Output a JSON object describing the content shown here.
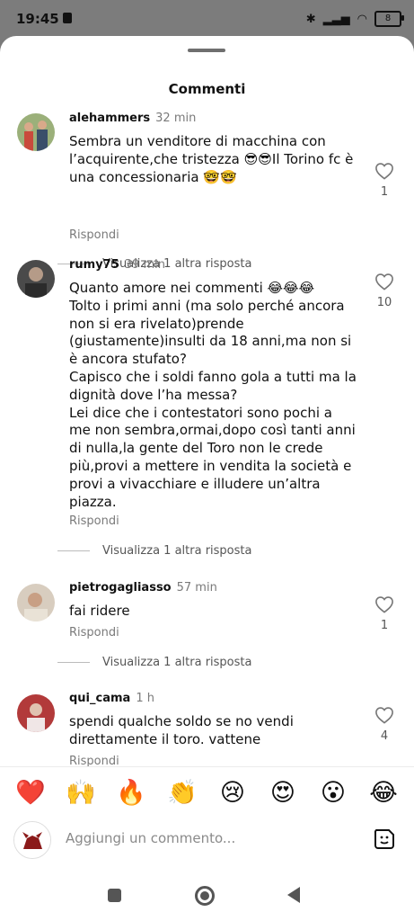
{
  "status": {
    "time": "19:45",
    "battery": "8"
  },
  "sheet": {
    "title": "Commenti"
  },
  "comments": [
    {
      "user": "alehammers",
      "time": "32 min",
      "text": "Sembra un venditore di macchina con l’acquirente,che tristezza 😎😎Il Torino fc è una concessionaria 🤓🤓",
      "reply": "Rispondi",
      "likes": "1",
      "more": "Visualizza 1 altra risposta"
    },
    {
      "user": "rumy75",
      "time": "39 min",
      "text": "Quanto amore nei commenti 😂😂😂\nTolto i primi anni (ma solo perché ancora non si era rivelato)prende (giustamente)insulti da 18 anni,ma non si è ancora stufato?\nCapisco che i soldi fanno gola a tutti ma la dignità dove l’ha messa?\nLei dice che i contestatori sono pochi a me non sembra,ormai,dopo così tanti anni di nulla,la gente del Toro non le crede più,provi a mettere in vendita la società e provi a vivacchiare e illudere un’altra piazza.",
      "reply": "Rispondi",
      "likes": "10",
      "more": "Visualizza 1 altra risposta"
    },
    {
      "user": "pietrogagliasso",
      "time": "57 min",
      "text": "fai ridere",
      "reply": "Rispondi",
      "likes": "1",
      "more": "Visualizza 1 altra risposta"
    },
    {
      "user": "qui_cama",
      "time": "1 h",
      "text": "spendi qualche soldo se no vendi direttamente il toro. vattene",
      "reply": "Rispondi",
      "likes": "4"
    }
  ],
  "emojis": [
    "❤️",
    "🙌",
    "🔥",
    "👏",
    "😢",
    "😍",
    "😮",
    "😂"
  ],
  "composer": {
    "placeholder": "Aggiungi un commento..."
  }
}
